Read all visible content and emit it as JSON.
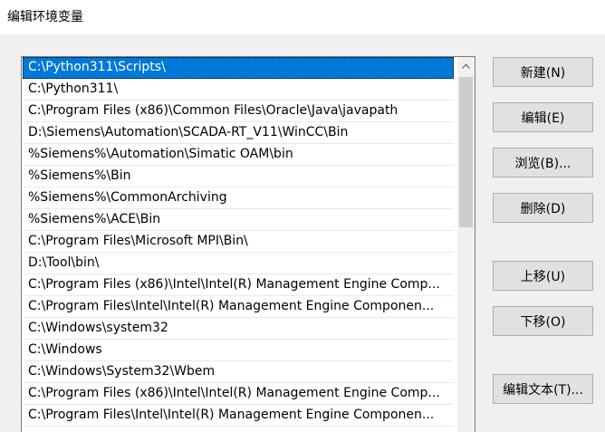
{
  "window": {
    "title": "编辑环境变量"
  },
  "path_list": {
    "items": [
      "C:\\Python311\\Scripts\\",
      "C:\\Python311\\",
      "C:\\Program Files (x86)\\Common Files\\Oracle\\Java\\javapath",
      "D:\\Siemens\\Automation\\SCADA-RT_V11\\WinCC\\Bin",
      "%Siemens%\\Automation\\Simatic OAM\\bin",
      "%Siemens%\\Bin",
      "%Siemens%\\CommonArchiving",
      "%Siemens%\\ACE\\Bin",
      "C:\\Program Files\\Microsoft MPI\\Bin\\",
      "D:\\Tool\\bin\\",
      "C:\\Program Files (x86)\\Intel\\Intel(R) Management Engine Comp...",
      "C:\\Program Files\\Intel\\Intel(R) Management Engine Componen...",
      "C:\\Windows\\system32",
      "C:\\Windows",
      "C:\\Windows\\System32\\Wbem",
      "C:\\Program Files (x86)\\Intel\\Intel(R) Management Engine Comp...",
      "C:\\Program Files\\Intel\\Intel(R) Management Engine Componen..."
    ],
    "selected_index": 0
  },
  "buttons": {
    "new": "新建(N)",
    "edit": "编辑(E)",
    "browse": "浏览(B)...",
    "delete": "删除(D)",
    "move_up": "上移(U)",
    "move_down": "下移(O)",
    "edit_text": "编辑文本(T)..."
  },
  "icons": {
    "scroll_up": "chevron-up-icon"
  },
  "colors": {
    "selection": "#0078d7"
  }
}
